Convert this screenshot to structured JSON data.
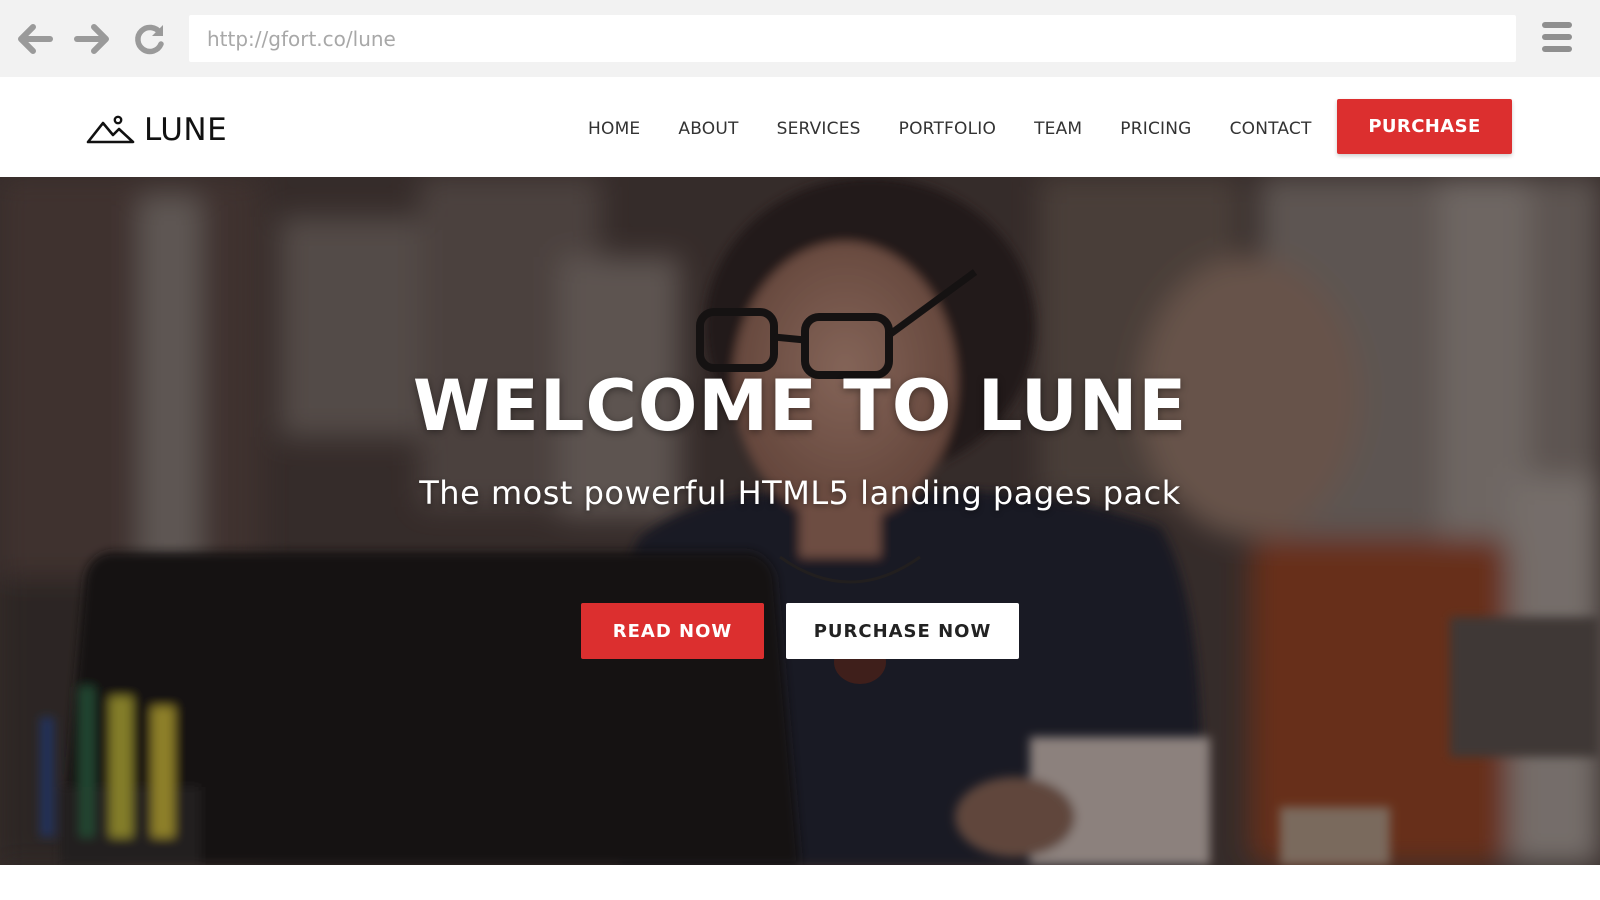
{
  "browser": {
    "url": "http://gfort.co/lune",
    "icons": [
      "back-arrow-icon",
      "forward-arrow-icon",
      "reload-icon",
      "hamburger-menu-icon"
    ],
    "icon_color": "#9a9a9a"
  },
  "header": {
    "logo_text": "LUNE",
    "logo_icon": "mountain-icon",
    "nav_items": [
      "HOME",
      "ABOUT",
      "SERVICES",
      "PORTFOLIO",
      "TEAM",
      "PRICING",
      "CONTACT"
    ],
    "purchase_label": "PURCHASE"
  },
  "hero": {
    "title": "WELCOME TO LUNE",
    "subtitle": "The most powerful HTML5 landing pages pack",
    "primary_button": "READ NOW",
    "secondary_button": "PURCHASE NOW"
  },
  "colors": {
    "accent": "#dc2f2f",
    "browser_bar": "#f2f2f2",
    "text_dark": "#333333",
    "white": "#ffffff"
  }
}
